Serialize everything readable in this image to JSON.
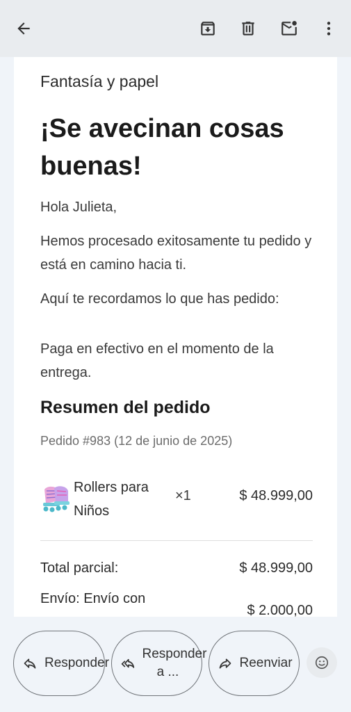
{
  "store_name": "Fantasía y papel",
  "headline": "¡Se avecinan cosas buenas!",
  "greeting": "Hola Julieta,",
  "processed_text": "Hemos procesado exitosamente tu pedido y está en camino hacia ti.",
  "reminder_text": "Aquí te recordamos lo que has pedido:",
  "payment_text": "Paga en efectivo en el momento de la entrega.",
  "summary": {
    "title": "Resumen del pedido",
    "order_meta": "Pedido #983 (12 de junio de 2025)"
  },
  "product": {
    "name": "Rollers para Niños",
    "quantity": "×1",
    "price": "$ 48.999,00"
  },
  "totals": {
    "subtotal_label": "Total parcial:",
    "subtotal_value": "$ 48.999,00",
    "shipping_label": "Envío: Envío con",
    "shipping_value": "$ 2.000,00"
  },
  "actions": {
    "reply": "Responder",
    "reply_all": "Responder a ...",
    "forward": "Reenviar"
  },
  "icons": {
    "back": "arrow-left-icon",
    "archive": "archive-icon",
    "delete": "trash-icon",
    "mark_unread": "mark-unread-icon",
    "more": "more-vertical-icon",
    "emoji": "emoji-icon"
  },
  "colors": {
    "topbar": "#e9ecef",
    "background": "#f0f4f9",
    "card": "#ffffff"
  }
}
